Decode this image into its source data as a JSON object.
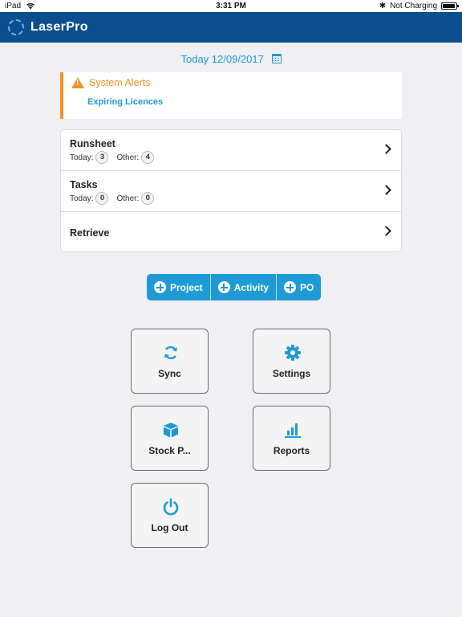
{
  "statusbar": {
    "device": "iPad",
    "time": "3:31 PM",
    "charging": "Not Charging"
  },
  "app": {
    "title": "LaserPro"
  },
  "date": {
    "label": "Today 12/09/2017"
  },
  "alerts": {
    "title": "System Alerts",
    "items": [
      "Expiring Licences"
    ]
  },
  "list": {
    "items": [
      {
        "title": "Runsheet",
        "today_label": "Today:",
        "today_count": "3",
        "other_label": "Other:",
        "other_count": "4"
      },
      {
        "title": "Tasks",
        "today_label": "Today:",
        "today_count": "0",
        "other_label": "Other:",
        "other_count": "0"
      },
      {
        "title": "Retrieve"
      }
    ]
  },
  "actions": {
    "project": "Project",
    "activity": "Activity",
    "po": "PO"
  },
  "tiles": {
    "sync": "Sync",
    "settings": "Settings",
    "stock": "Stock P...",
    "reports": "Reports",
    "logout": "Log Out"
  },
  "colors": {
    "primary": "#0b4f8f",
    "accent": "#1e9bd7",
    "warning": "#f0932a",
    "background": "#efeff4"
  }
}
